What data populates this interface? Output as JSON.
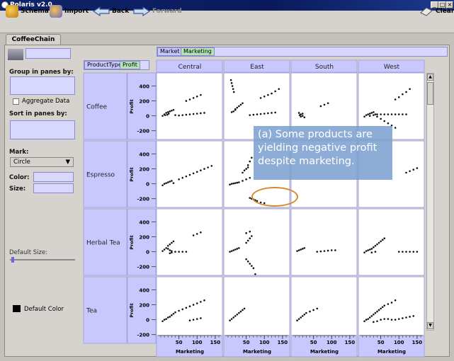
{
  "window": {
    "title": "Polaris v2.0"
  },
  "toolbar": {
    "schema": "Schema",
    "import": "Import",
    "back": "Back",
    "forward": "Forward",
    "clear": "Clear"
  },
  "tab": {
    "label": "CoffeeChain"
  },
  "left_panel": {
    "group_label": "Group in panes by:",
    "aggregate_label": "Aggregate Data",
    "sort_label": "Sort in panes by:",
    "mark_label": "Mark:",
    "mark_value": "Circle",
    "color_label": "Color:",
    "size_label": "Size:",
    "default_size_label": "Default Size:",
    "default_color_label": "Default Color"
  },
  "shelves": {
    "columns": [
      "Market",
      "Marketing"
    ],
    "rows": [
      "ProductType",
      "Profit"
    ]
  },
  "annotation": {
    "text": "(a) Some products are yielding negative profit despite marketing."
  },
  "chart_data": {
    "type": "scatter",
    "columns": [
      "Central",
      "East",
      "South",
      "West"
    ],
    "rows": [
      "Coffee",
      "Espresso",
      "Herbal Tea",
      "Tea"
    ],
    "ylabel": "Profit",
    "xlabel": "Marketing",
    "yticks": [
      "400",
      "200",
      "0",
      "-200"
    ],
    "xticks": [
      "50",
      "100",
      "150"
    ],
    "ylim": [
      -250,
      500
    ],
    "xlim": [
      0,
      160
    ],
    "cells": {
      "Coffee": {
        "Central": [
          [
            5,
            0
          ],
          [
            10,
            20
          ],
          [
            15,
            40
          ],
          [
            20,
            50
          ],
          [
            25,
            60
          ],
          [
            30,
            70
          ],
          [
            35,
            80
          ],
          [
            12,
            10
          ],
          [
            18,
            15
          ],
          [
            22,
            30
          ],
          [
            40,
            10
          ],
          [
            50,
            5
          ],
          [
            60,
            10
          ],
          [
            70,
            15
          ],
          [
            80,
            20
          ],
          [
            90,
            25
          ],
          [
            100,
            30
          ],
          [
            110,
            35
          ],
          [
            120,
            40
          ],
          [
            70,
            200
          ],
          [
            80,
            220
          ],
          [
            90,
            240
          ],
          [
            100,
            260
          ],
          [
            110,
            280
          ]
        ],
        "East": [
          [
            8,
            480
          ],
          [
            10,
            440
          ],
          [
            12,
            400
          ],
          [
            14,
            360
          ],
          [
            16,
            320
          ],
          [
            20,
            90
          ],
          [
            25,
            110
          ],
          [
            30,
            130
          ],
          [
            35,
            150
          ],
          [
            40,
            170
          ],
          [
            10,
            50
          ],
          [
            15,
            60
          ],
          [
            20,
            80
          ],
          [
            60,
            10
          ],
          [
            70,
            15
          ],
          [
            80,
            20
          ],
          [
            90,
            25
          ],
          [
            100,
            30
          ],
          [
            110,
            35
          ],
          [
            120,
            40
          ],
          [
            130,
            45
          ],
          [
            90,
            240
          ],
          [
            100,
            260
          ],
          [
            110,
            280
          ],
          [
            120,
            300
          ],
          [
            130,
            330
          ],
          [
            140,
            360
          ]
        ],
        "South": [
          [
            10,
            40
          ],
          [
            15,
            20
          ],
          [
            20,
            0
          ],
          [
            25,
            -20
          ],
          [
            20,
            30
          ],
          [
            15,
            -10
          ],
          [
            12,
            10
          ],
          [
            70,
            130
          ],
          [
            80,
            150
          ],
          [
            90,
            170
          ]
        ],
        "West": [
          [
            5,
            -10
          ],
          [
            10,
            10
          ],
          [
            15,
            20
          ],
          [
            20,
            30
          ],
          [
            25,
            40
          ],
          [
            30,
            50
          ],
          [
            35,
            20
          ],
          [
            40,
            -10
          ],
          [
            50,
            -40
          ],
          [
            60,
            -70
          ],
          [
            70,
            -100
          ],
          [
            80,
            -130
          ],
          [
            90,
            -160
          ],
          [
            20,
            0
          ],
          [
            30,
            10
          ],
          [
            40,
            20
          ],
          [
            50,
            20
          ],
          [
            60,
            20
          ],
          [
            70,
            20
          ],
          [
            80,
            20
          ],
          [
            90,
            20
          ],
          [
            100,
            20
          ],
          [
            110,
            20
          ],
          [
            120,
            20
          ],
          [
            90,
            220
          ],
          [
            100,
            250
          ],
          [
            110,
            290
          ],
          [
            120,
            320
          ],
          [
            130,
            360
          ]
        ]
      },
      "Espresso": {
        "Central": [
          [
            5,
            -20
          ],
          [
            10,
            0
          ],
          [
            15,
            10
          ],
          [
            20,
            20
          ],
          [
            25,
            30
          ],
          [
            30,
            40
          ],
          [
            35,
            10
          ],
          [
            50,
            60
          ],
          [
            60,
            80
          ],
          [
            70,
            100
          ],
          [
            80,
            120
          ],
          [
            90,
            140
          ],
          [
            100,
            160
          ],
          [
            110,
            180
          ],
          [
            120,
            200
          ],
          [
            130,
            220
          ],
          [
            140,
            240
          ]
        ],
        "East": [
          [
            5,
            -10
          ],
          [
            10,
            0
          ],
          [
            15,
            5
          ],
          [
            20,
            10
          ],
          [
            25,
            15
          ],
          [
            30,
            20
          ],
          [
            40,
            40
          ],
          [
            50,
            60
          ],
          [
            60,
            80
          ],
          [
            40,
            150
          ],
          [
            50,
            200
          ],
          [
            55,
            250
          ],
          [
            60,
            300
          ],
          [
            65,
            350
          ],
          [
            45,
            180
          ],
          [
            55,
            220
          ],
          [
            60,
            -190
          ],
          [
            70,
            -210
          ],
          [
            80,
            -230
          ],
          [
            90,
            -250
          ],
          [
            100,
            -260
          ],
          [
            65,
            -200
          ],
          [
            75,
            -220
          ]
        ],
        "South": [],
        "West": [
          [
            120,
            150
          ],
          [
            130,
            170
          ],
          [
            140,
            190
          ],
          [
            150,
            210
          ]
        ]
      },
      "Herbal Tea": {
        "Central": [
          [
            5,
            10
          ],
          [
            10,
            30
          ],
          [
            15,
            50
          ],
          [
            20,
            80
          ],
          [
            25,
            100
          ],
          [
            30,
            120
          ],
          [
            35,
            140
          ],
          [
            20,
            40
          ],
          [
            25,
            20
          ],
          [
            30,
            10
          ],
          [
            40,
            0
          ],
          [
            50,
            0
          ],
          [
            60,
            0
          ],
          [
            70,
            0
          ],
          [
            90,
            220
          ],
          [
            100,
            240
          ],
          [
            110,
            260
          ],
          [
            25,
            -20
          ],
          [
            30,
            -10
          ]
        ],
        "East": [
          [
            5,
            0
          ],
          [
            10,
            10
          ],
          [
            15,
            20
          ],
          [
            20,
            30
          ],
          [
            25,
            40
          ],
          [
            30,
            50
          ],
          [
            50,
            120
          ],
          [
            55,
            150
          ],
          [
            60,
            180
          ],
          [
            65,
            210
          ],
          [
            50,
            250
          ],
          [
            60,
            270
          ],
          [
            50,
            -100
          ],
          [
            55,
            -130
          ],
          [
            60,
            -160
          ],
          [
            65,
            -190
          ],
          [
            70,
            -220
          ],
          [
            75,
            -300
          ]
        ],
        "South": [
          [
            5,
            10
          ],
          [
            10,
            20
          ],
          [
            15,
            30
          ],
          [
            20,
            40
          ],
          [
            25,
            50
          ],
          [
            60,
            0
          ],
          [
            70,
            5
          ],
          [
            80,
            10
          ],
          [
            90,
            15
          ],
          [
            100,
            20
          ],
          [
            110,
            20
          ]
        ],
        "West": [
          [
            5,
            -10
          ],
          [
            10,
            10
          ],
          [
            15,
            20
          ],
          [
            20,
            30
          ],
          [
            25,
            40
          ],
          [
            30,
            60
          ],
          [
            35,
            80
          ],
          [
            40,
            100
          ],
          [
            45,
            120
          ],
          [
            50,
            140
          ],
          [
            55,
            160
          ],
          [
            60,
            180
          ],
          [
            25,
            -10
          ],
          [
            35,
            0
          ],
          [
            100,
            0
          ],
          [
            110,
            0
          ],
          [
            120,
            0
          ],
          [
            130,
            0
          ],
          [
            140,
            0
          ],
          [
            150,
            0
          ]
        ]
      },
      "Tea": {
        "Central": [
          [
            5,
            -20
          ],
          [
            10,
            0
          ],
          [
            15,
            10
          ],
          [
            20,
            30
          ],
          [
            25,
            40
          ],
          [
            30,
            60
          ],
          [
            35,
            80
          ],
          [
            40,
            100
          ],
          [
            50,
            120
          ],
          [
            60,
            140
          ],
          [
            70,
            160
          ],
          [
            80,
            180
          ],
          [
            90,
            200
          ],
          [
            100,
            220
          ],
          [
            110,
            240
          ],
          [
            120,
            260
          ],
          [
            80,
            -10
          ],
          [
            90,
            0
          ],
          [
            100,
            10
          ],
          [
            110,
            20
          ]
        ],
        "East": [
          [
            5,
            -10
          ],
          [
            10,
            10
          ],
          [
            15,
            30
          ],
          [
            20,
            50
          ],
          [
            25,
            70
          ],
          [
            30,
            90
          ],
          [
            35,
            110
          ],
          [
            40,
            130
          ],
          [
            45,
            150
          ]
        ],
        "South": [
          [
            5,
            -10
          ],
          [
            10,
            10
          ],
          [
            15,
            30
          ],
          [
            20,
            50
          ],
          [
            25,
            70
          ],
          [
            30,
            90
          ],
          [
            40,
            110
          ],
          [
            50,
            130
          ],
          [
            60,
            150
          ]
        ],
        "West": [
          [
            5,
            -20
          ],
          [
            10,
            0
          ],
          [
            15,
            10
          ],
          [
            20,
            30
          ],
          [
            25,
            50
          ],
          [
            30,
            70
          ],
          [
            35,
            90
          ],
          [
            40,
            110
          ],
          [
            45,
            130
          ],
          [
            50,
            150
          ],
          [
            55,
            170
          ],
          [
            60,
            190
          ],
          [
            70,
            210
          ],
          [
            80,
            230
          ],
          [
            90,
            260
          ],
          [
            30,
            -30
          ],
          [
            40,
            -20
          ],
          [
            50,
            0
          ],
          [
            60,
            10
          ],
          [
            70,
            10
          ],
          [
            80,
            0
          ],
          [
            90,
            0
          ],
          [
            100,
            10
          ],
          [
            110,
            20
          ],
          [
            120,
            30
          ],
          [
            130,
            40
          ],
          [
            140,
            50
          ]
        ]
      }
    }
  },
  "colors": {
    "shelf": "#c8c8ff",
    "callout": "#8fb0d6",
    "highlight": "#d58a2a",
    "mark": "#111111"
  }
}
